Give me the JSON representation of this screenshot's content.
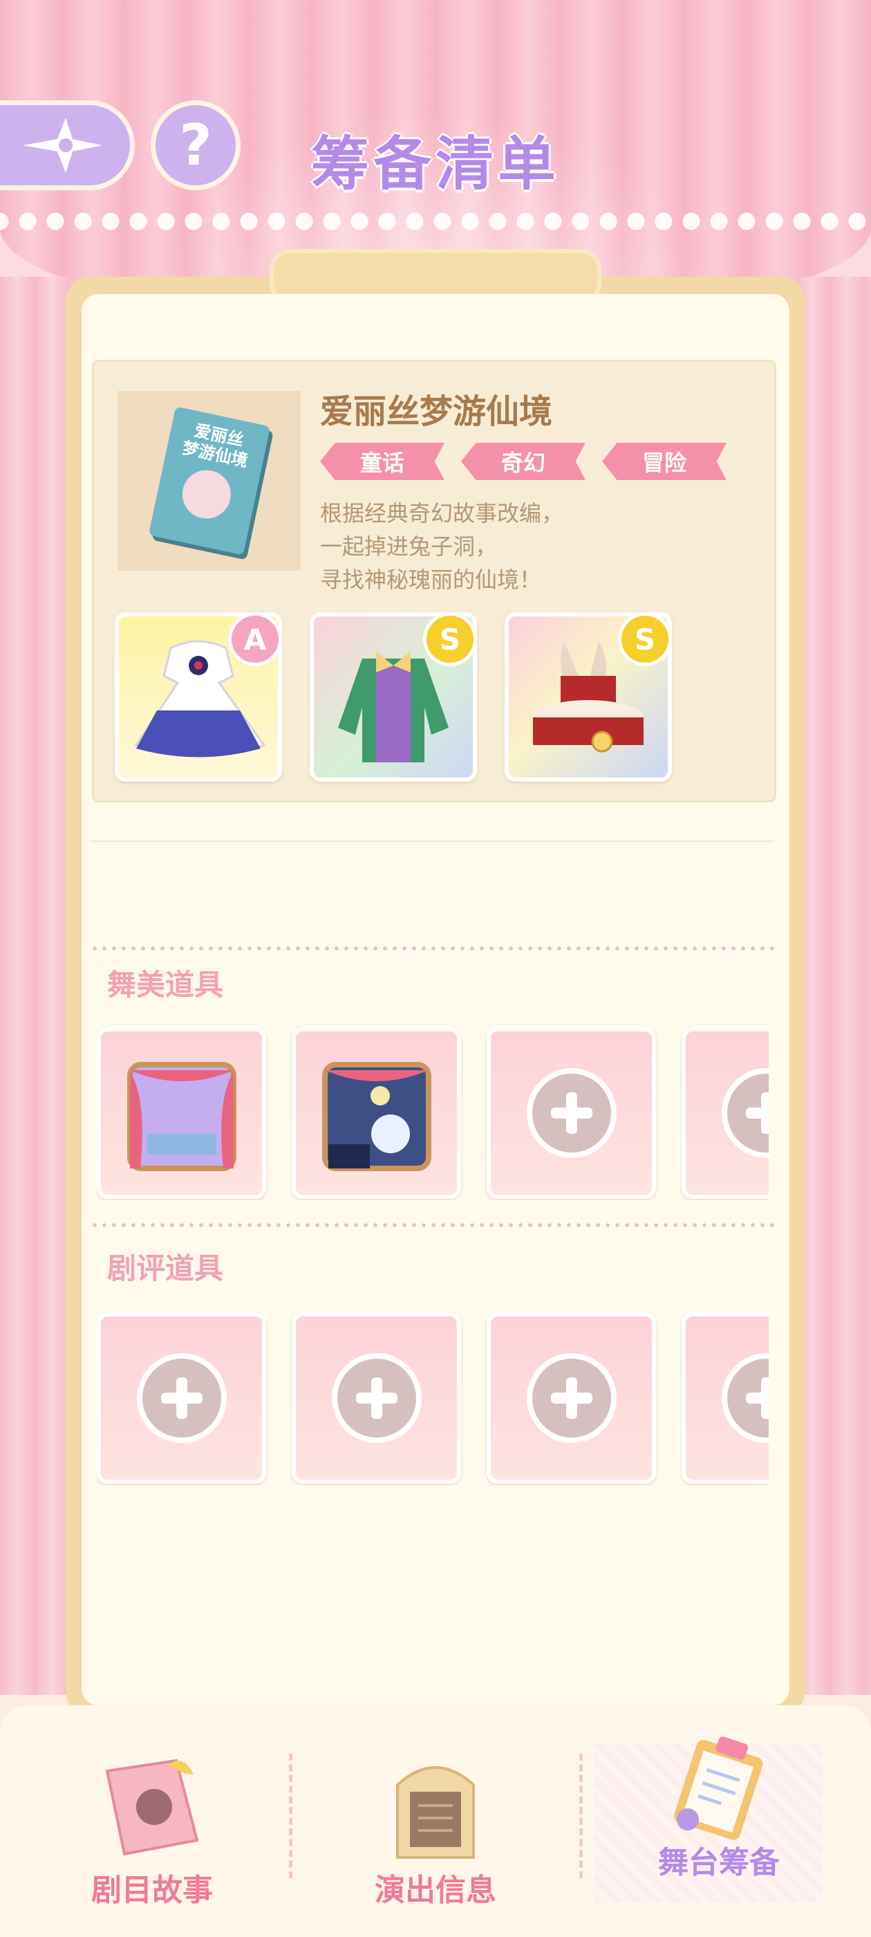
{
  "header": {
    "title": "筹备清单",
    "help_label": "?"
  },
  "story": {
    "title": "爱丽丝梦游仙境",
    "book_cover_text": [
      "爱丽丝",
      "梦游仙境"
    ],
    "tags": [
      "童话",
      "奇幻",
      "冒险"
    ],
    "description": [
      "根据经典奇幻故事改编，",
      "一起掉进兔子洞，",
      "寻找神秘瑰丽的仙境！"
    ],
    "outfits": [
      {
        "item": "blue-dress",
        "grade": "A"
      },
      {
        "item": "green-jacket-outfit",
        "grade": "S"
      },
      {
        "item": "rabbit-top-hat",
        "grade": "S"
      }
    ]
  },
  "stage_props": {
    "label": "舞美道具",
    "slots": [
      "theater-backdrop-pink",
      "theater-backdrop-night",
      "empty",
      "empty"
    ]
  },
  "review_props": {
    "label": "剧评道具",
    "slots": [
      "empty",
      "empty",
      "empty",
      "empty"
    ]
  },
  "bottom_nav": {
    "items": [
      {
        "label": "剧目故事",
        "icon": "storybook-icon"
      },
      {
        "label": "演出信息",
        "icon": "info-board-icon"
      },
      {
        "label": "舞台筹备",
        "icon": "clipboard-icon",
        "active": true
      }
    ]
  },
  "colors": {
    "accent_purple": "#b48ae8",
    "accent_pink": "#f590ab",
    "panel_cream": "#fffaec"
  }
}
